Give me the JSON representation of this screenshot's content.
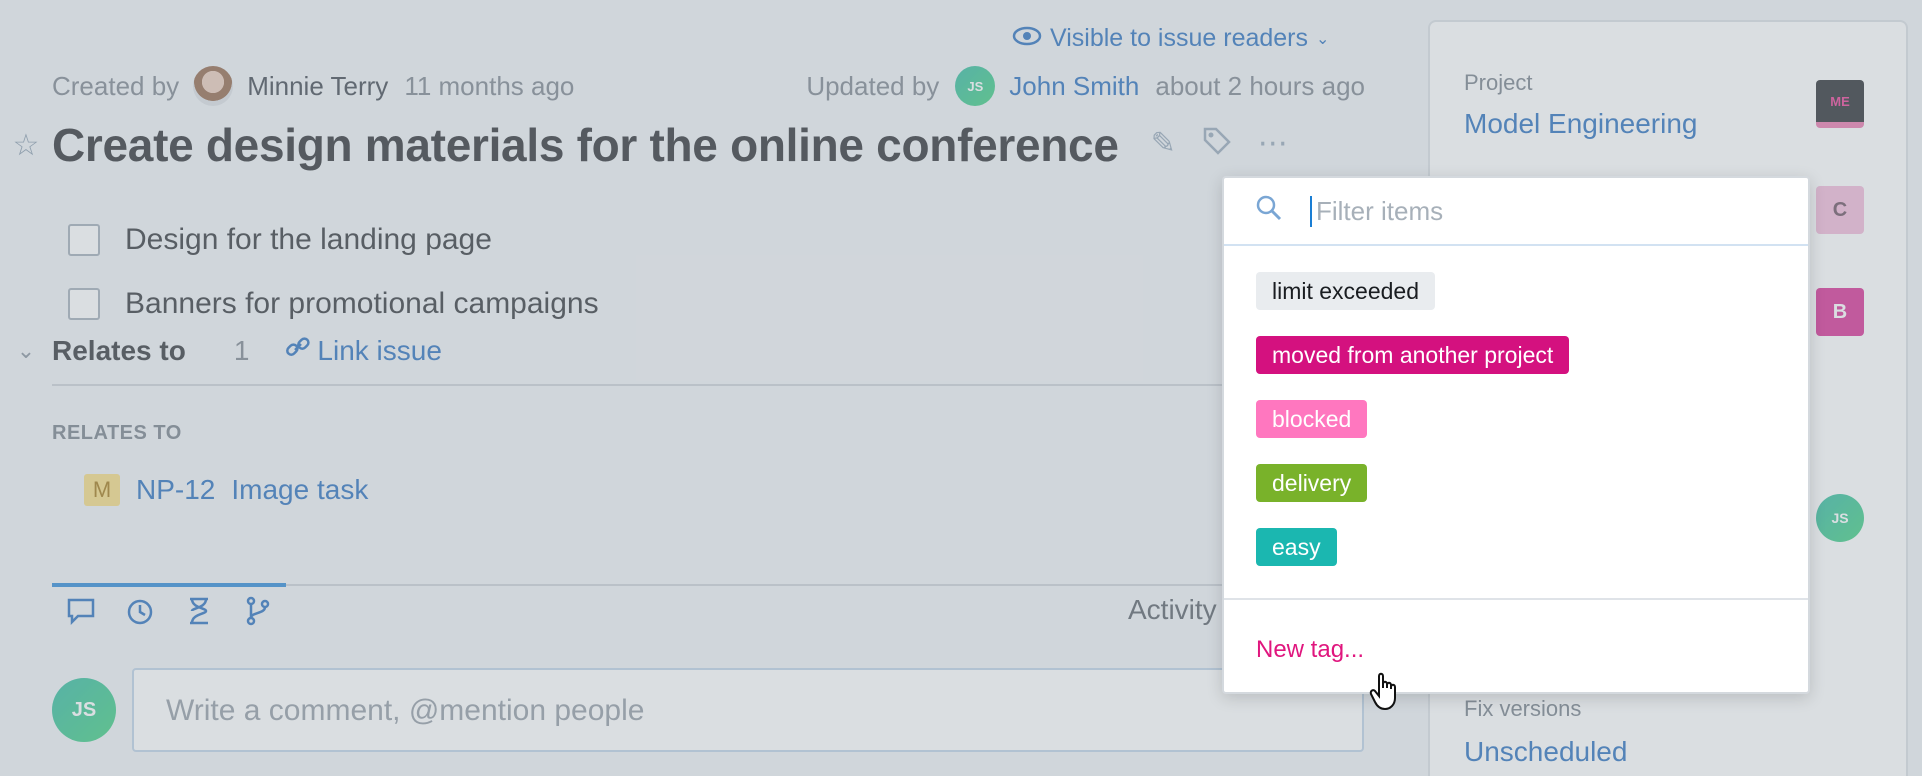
{
  "header": {
    "visibility_label": "Visible to issue readers",
    "created_by_label": "Created by",
    "created_by_name": "Minnie Terry",
    "created_time": "11 months ago",
    "updated_by_label": "Updated by",
    "updated_by_name": "John Smith",
    "updated_time": "about 2 hours ago",
    "updated_by_initials": "JS"
  },
  "issue": {
    "title": "Create design materials for the online conference",
    "checklist": [
      {
        "label": "Design for the landing page",
        "checked": false
      },
      {
        "label": "Banners for promotional campaigns",
        "checked": false
      }
    ]
  },
  "relations": {
    "header_label": "Relates to",
    "count": "1",
    "link_issue_label": "Link issue",
    "section_caption": "RELATES TO",
    "items": [
      {
        "project_badge": "M",
        "id": "NP-12",
        "summary": "Image task"
      }
    ]
  },
  "activity": {
    "tab_label": "Activity",
    "comment_placeholder": "Write a comment, @mention people",
    "comment_avatar_initials": "JS"
  },
  "right_panel": {
    "project_label": "Project",
    "project_value": "Model Engineering",
    "project_avatar": "ME",
    "avatar_c": "C",
    "avatar_b": "B",
    "avatar_js": "JS",
    "fix_versions_label": "Fix versions",
    "fix_versions_value": "Unscheduled"
  },
  "tag_popup": {
    "search_placeholder": "Filter items",
    "tags": [
      {
        "label": "limit exceeded",
        "color": "#e9ecef"
      },
      {
        "label": "moved from another project",
        "color": "#d4117f"
      },
      {
        "label": "blocked",
        "color": "#ff77bf"
      },
      {
        "label": "delivery",
        "color": "#79b22a"
      },
      {
        "label": "easy",
        "color": "#1bb7b0"
      }
    ],
    "new_tag_label": "New tag..."
  }
}
